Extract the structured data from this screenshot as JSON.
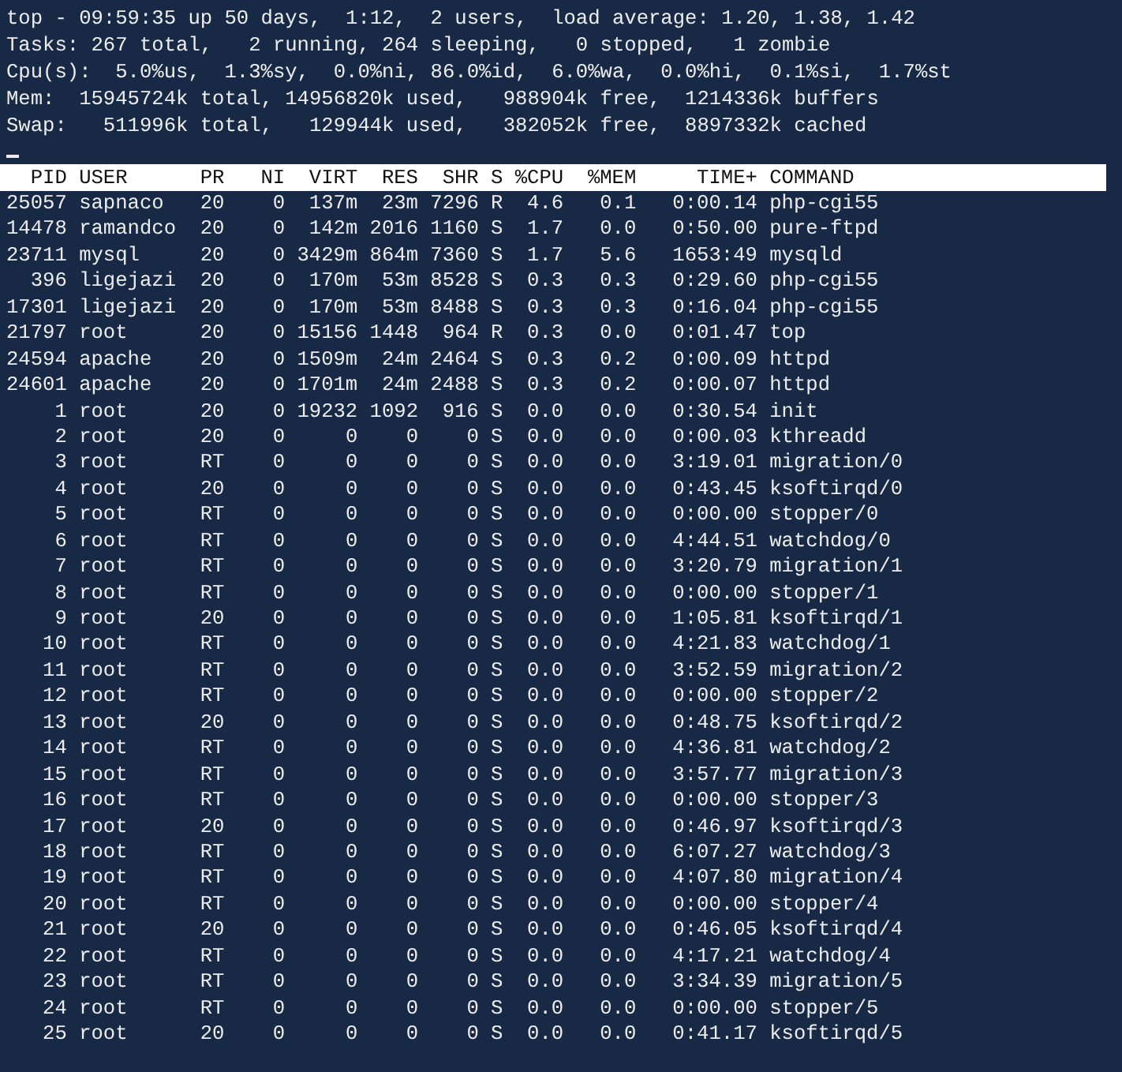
{
  "summary": [
    "top - 09:59:35 up 50 days,  1:12,  2 users,  load average: 1.20, 1.38, 1.42",
    "Tasks: 267 total,   2 running, 264 sleeping,   0 stopped,   1 zombie",
    "Cpu(s):  5.0%us,  1.3%sy,  0.0%ni, 86.0%id,  6.0%wa,  0.0%hi,  0.1%si,  1.7%st",
    "Mem:  15945724k total, 14956820k used,   988904k free,  1214336k buffers",
    "Swap:   511996k total,   129944k used,   382052k free,  8897332k cached"
  ],
  "table": {
    "columns": [
      "PID",
      "USER",
      "PR",
      "NI",
      "VIRT",
      "RES",
      "SHR",
      "S",
      "%CPU",
      "%MEM",
      "TIME+",
      "COMMAND"
    ],
    "rows": [
      [
        "25057",
        "sapnaco",
        "20",
        "0",
        "137m",
        "23m",
        "7296",
        "R",
        "4.6",
        "0.1",
        "0:00.14",
        "php-cgi55"
      ],
      [
        "14478",
        "ramandco",
        "20",
        "0",
        "142m",
        "2016",
        "1160",
        "S",
        "1.7",
        "0.0",
        "0:50.00",
        "pure-ftpd"
      ],
      [
        "23711",
        "mysql",
        "20",
        "0",
        "3429m",
        "864m",
        "7360",
        "S",
        "1.7",
        "5.6",
        "1653:49",
        "mysqld"
      ],
      [
        "396",
        "ligejazi",
        "20",
        "0",
        "170m",
        "53m",
        "8528",
        "S",
        "0.3",
        "0.3",
        "0:29.60",
        "php-cgi55"
      ],
      [
        "17301",
        "ligejazi",
        "20",
        "0",
        "170m",
        "53m",
        "8488",
        "S",
        "0.3",
        "0.3",
        "0:16.04",
        "php-cgi55"
      ],
      [
        "21797",
        "root",
        "20",
        "0",
        "15156",
        "1448",
        "964",
        "R",
        "0.3",
        "0.0",
        "0:01.47",
        "top"
      ],
      [
        "24594",
        "apache",
        "20",
        "0",
        "1509m",
        "24m",
        "2464",
        "S",
        "0.3",
        "0.2",
        "0:00.09",
        "httpd"
      ],
      [
        "24601",
        "apache",
        "20",
        "0",
        "1701m",
        "24m",
        "2488",
        "S",
        "0.3",
        "0.2",
        "0:00.07",
        "httpd"
      ],
      [
        "1",
        "root",
        "20",
        "0",
        "19232",
        "1092",
        "916",
        "S",
        "0.0",
        "0.0",
        "0:30.54",
        "init"
      ],
      [
        "2",
        "root",
        "20",
        "0",
        "0",
        "0",
        "0",
        "S",
        "0.0",
        "0.0",
        "0:00.03",
        "kthreadd"
      ],
      [
        "3",
        "root",
        "RT",
        "0",
        "0",
        "0",
        "0",
        "S",
        "0.0",
        "0.0",
        "3:19.01",
        "migration/0"
      ],
      [
        "4",
        "root",
        "20",
        "0",
        "0",
        "0",
        "0",
        "S",
        "0.0",
        "0.0",
        "0:43.45",
        "ksoftirqd/0"
      ],
      [
        "5",
        "root",
        "RT",
        "0",
        "0",
        "0",
        "0",
        "S",
        "0.0",
        "0.0",
        "0:00.00",
        "stopper/0"
      ],
      [
        "6",
        "root",
        "RT",
        "0",
        "0",
        "0",
        "0",
        "S",
        "0.0",
        "0.0",
        "4:44.51",
        "watchdog/0"
      ],
      [
        "7",
        "root",
        "RT",
        "0",
        "0",
        "0",
        "0",
        "S",
        "0.0",
        "0.0",
        "3:20.79",
        "migration/1"
      ],
      [
        "8",
        "root",
        "RT",
        "0",
        "0",
        "0",
        "0",
        "S",
        "0.0",
        "0.0",
        "0:00.00",
        "stopper/1"
      ],
      [
        "9",
        "root",
        "20",
        "0",
        "0",
        "0",
        "0",
        "S",
        "0.0",
        "0.0",
        "1:05.81",
        "ksoftirqd/1"
      ],
      [
        "10",
        "root",
        "RT",
        "0",
        "0",
        "0",
        "0",
        "S",
        "0.0",
        "0.0",
        "4:21.83",
        "watchdog/1"
      ],
      [
        "11",
        "root",
        "RT",
        "0",
        "0",
        "0",
        "0",
        "S",
        "0.0",
        "0.0",
        "3:52.59",
        "migration/2"
      ],
      [
        "12",
        "root",
        "RT",
        "0",
        "0",
        "0",
        "0",
        "S",
        "0.0",
        "0.0",
        "0:00.00",
        "stopper/2"
      ],
      [
        "13",
        "root",
        "20",
        "0",
        "0",
        "0",
        "0",
        "S",
        "0.0",
        "0.0",
        "0:48.75",
        "ksoftirqd/2"
      ],
      [
        "14",
        "root",
        "RT",
        "0",
        "0",
        "0",
        "0",
        "S",
        "0.0",
        "0.0",
        "4:36.81",
        "watchdog/2"
      ],
      [
        "15",
        "root",
        "RT",
        "0",
        "0",
        "0",
        "0",
        "S",
        "0.0",
        "0.0",
        "3:57.77",
        "migration/3"
      ],
      [
        "16",
        "root",
        "RT",
        "0",
        "0",
        "0",
        "0",
        "S",
        "0.0",
        "0.0",
        "0:00.00",
        "stopper/3"
      ],
      [
        "17",
        "root",
        "20",
        "0",
        "0",
        "0",
        "0",
        "S",
        "0.0",
        "0.0",
        "0:46.97",
        "ksoftirqd/3"
      ],
      [
        "18",
        "root",
        "RT",
        "0",
        "0",
        "0",
        "0",
        "S",
        "0.0",
        "0.0",
        "6:07.27",
        "watchdog/3"
      ],
      [
        "19",
        "root",
        "RT",
        "0",
        "0",
        "0",
        "0",
        "S",
        "0.0",
        "0.0",
        "4:07.80",
        "migration/4"
      ],
      [
        "20",
        "root",
        "RT",
        "0",
        "0",
        "0",
        "0",
        "S",
        "0.0",
        "0.0",
        "0:00.00",
        "stopper/4"
      ],
      [
        "21",
        "root",
        "20",
        "0",
        "0",
        "0",
        "0",
        "S",
        "0.0",
        "0.0",
        "0:46.05",
        "ksoftirqd/4"
      ],
      [
        "22",
        "root",
        "RT",
        "0",
        "0",
        "0",
        "0",
        "S",
        "0.0",
        "0.0",
        "4:17.21",
        "watchdog/4"
      ],
      [
        "23",
        "root",
        "RT",
        "0",
        "0",
        "0",
        "0",
        "S",
        "0.0",
        "0.0",
        "3:34.39",
        "migration/5"
      ],
      [
        "24",
        "root",
        "RT",
        "0",
        "0",
        "0",
        "0",
        "S",
        "0.0",
        "0.0",
        "0:00.00",
        "stopper/5"
      ],
      [
        "25",
        "root",
        "20",
        "0",
        "0",
        "0",
        "0",
        "S",
        "0.0",
        "0.0",
        "0:41.17",
        "ksoftirqd/5"
      ]
    ]
  }
}
